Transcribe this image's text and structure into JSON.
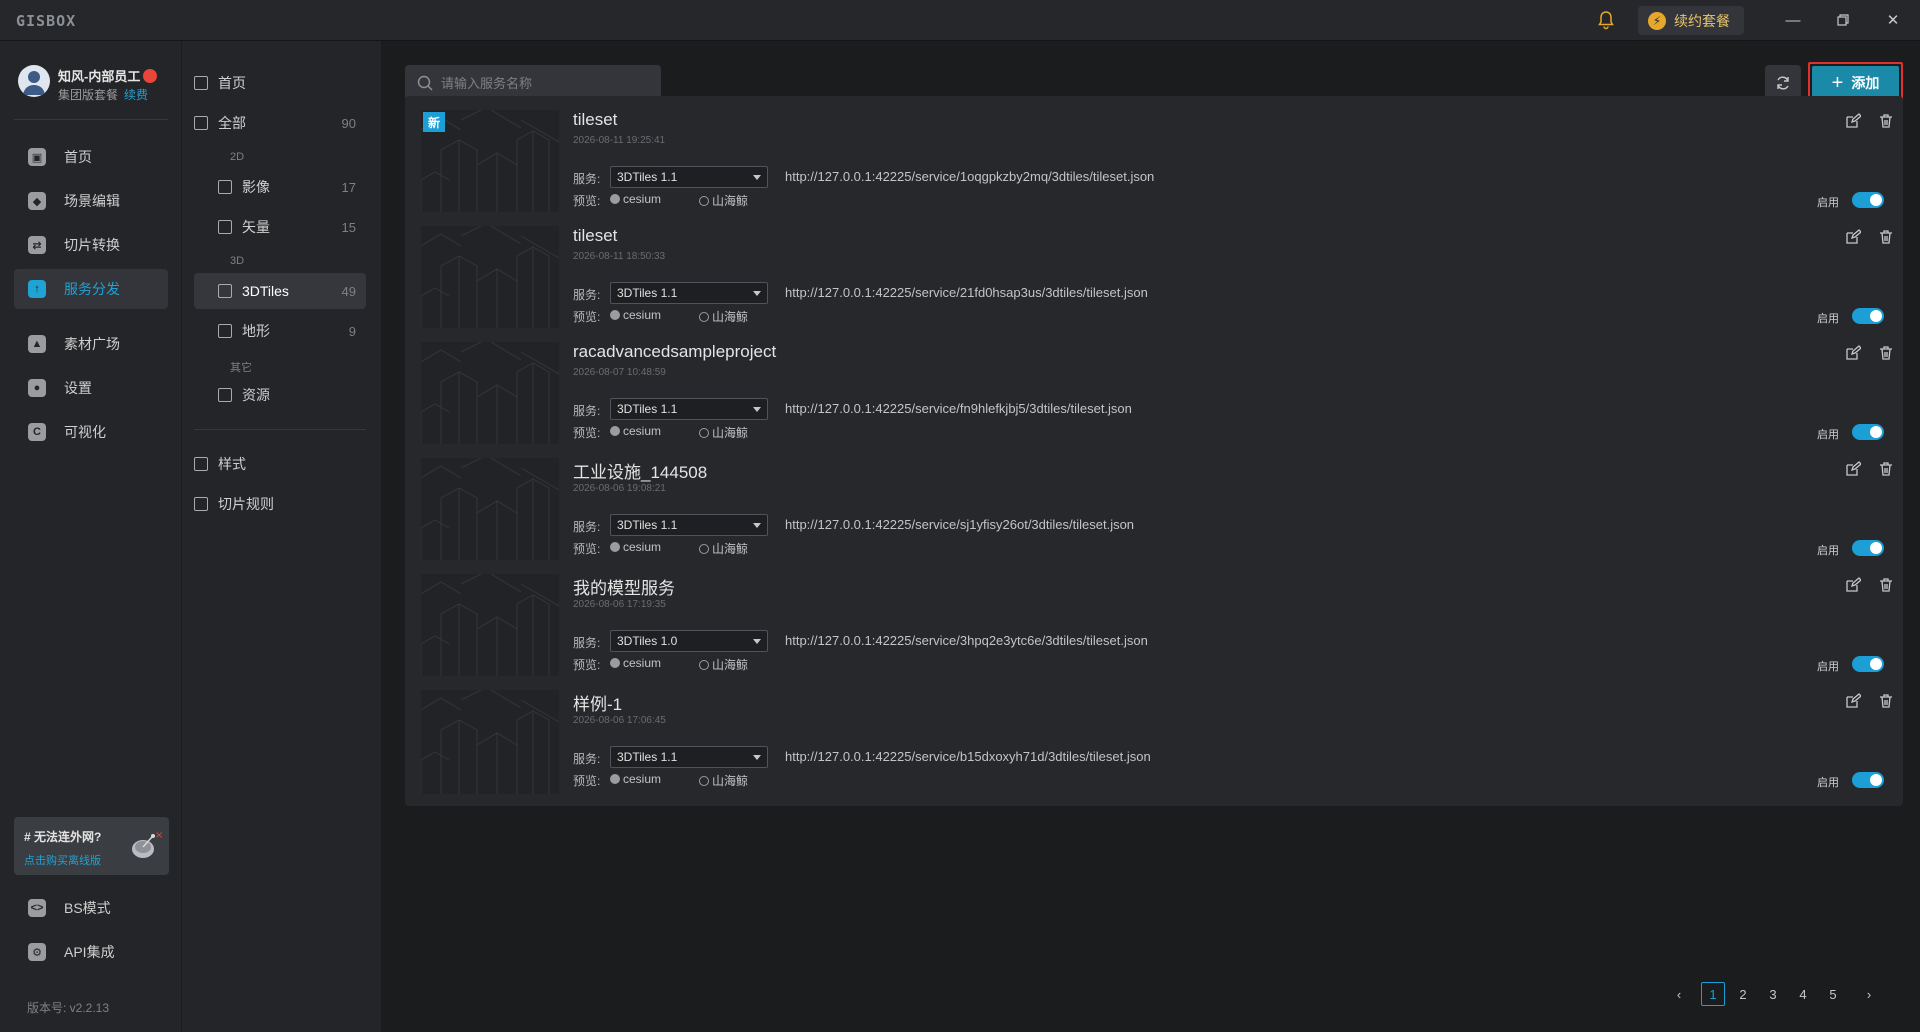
{
  "app": {
    "logo": "GISBOX",
    "renew_label": "续约套餐"
  },
  "user": {
    "name": "知风-内部员工",
    "plan": "集团版套餐",
    "renew_link": "续费"
  },
  "sidebar": {
    "items": [
      {
        "label": "首页",
        "icon": "home-icon"
      },
      {
        "label": "场景编辑",
        "icon": "cube-icon"
      },
      {
        "label": "切片转换",
        "icon": "convert-icon"
      },
      {
        "label": "服务分发",
        "icon": "upload-icon",
        "active": true
      },
      {
        "label": "素材广场",
        "icon": "image-icon"
      },
      {
        "label": "设置",
        "icon": "gear-icon"
      },
      {
        "label": "可视化",
        "icon": "visual-icon"
      }
    ],
    "promo": {
      "title": "# 无法连外网?",
      "link": "点击购买离线版"
    },
    "bottom": [
      {
        "label": "BS模式",
        "icon": "code-icon"
      },
      {
        "label": "API集成",
        "icon": "api-icon"
      }
    ],
    "version": "版本号: v2.2.13"
  },
  "subnav": {
    "home": "首页",
    "all": {
      "label": "全部",
      "count": "90"
    },
    "group_2d": "2D",
    "image": {
      "label": "影像",
      "count": "17"
    },
    "vector": {
      "label": "矢量",
      "count": "15"
    },
    "group_3d": "3D",
    "tiles3d": {
      "label": "3DTiles",
      "count": "49"
    },
    "terrain": {
      "label": "地形",
      "count": "9"
    },
    "group_other": "其它",
    "resource": {
      "label": "资源"
    },
    "style": "样式",
    "tile_rule": "切片规则"
  },
  "toolbar": {
    "search_placeholder": "请输入服务名称",
    "add_label": "添加"
  },
  "labels": {
    "service": "服务:",
    "preview": "预览:",
    "cesium": "cesium",
    "shanhai": "山海鲸",
    "enable": "启用",
    "new": "新"
  },
  "services": [
    {
      "name": "tileset",
      "date": "2026-08-11 19:25:41",
      "type": "3DTiles 1.1",
      "url": "http://127.0.0.1:42225/service/1oqgpkzby2mq/3dtiles/tileset.json",
      "is_new": true
    },
    {
      "name": "tileset",
      "date": "2026-08-11 18:50:33",
      "type": "3DTiles 1.1",
      "url": "http://127.0.0.1:42225/service/21fd0hsap3us/3dtiles/tileset.json"
    },
    {
      "name": "racadvancedsampleproject",
      "date": "2026-08-07 10:48:59",
      "type": "3DTiles 1.1",
      "url": "http://127.0.0.1:42225/service/fn9hlefkjbj5/3dtiles/tileset.json"
    },
    {
      "name": "工业设施_144508",
      "date": "2026-08-06 19:08:21",
      "type": "3DTiles 1.1",
      "url": "http://127.0.0.1:42225/service/sj1yfisy26ot/3dtiles/tileset.json"
    },
    {
      "name": "我的模型服务",
      "date": "2026-08-06 17:19:35",
      "type": "3DTiles 1.0",
      "url": "http://127.0.0.1:42225/service/3hpq2e3ytc6e/3dtiles/tileset.json"
    },
    {
      "name": "样例-1",
      "date": "2026-08-06 17:06:45",
      "type": "3DTiles 1.1",
      "url": "http://127.0.0.1:42225/service/b15dxoxyh71d/3dtiles/tileset.json"
    }
  ],
  "pagination": {
    "pages": [
      "1",
      "2",
      "3",
      "4",
      "5"
    ],
    "current": "1"
  },
  "colors": {
    "accent": "#1b9fd6",
    "highlight": "#e03131"
  }
}
